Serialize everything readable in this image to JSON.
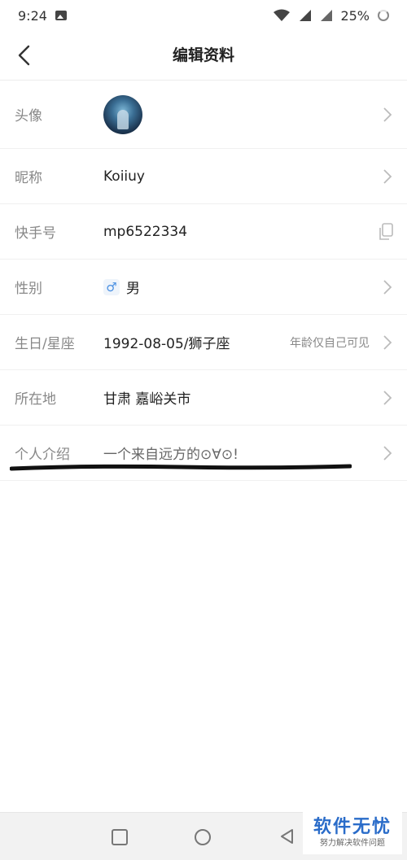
{
  "status_bar": {
    "time": "9:24",
    "battery": "25%"
  },
  "header": {
    "title": "编辑资料"
  },
  "rows": {
    "avatar": {
      "label": "头像"
    },
    "nickname": {
      "label": "昵称",
      "value": "Koiiuy"
    },
    "kuaishou_id": {
      "label": "快手号",
      "value": "mp6522334"
    },
    "gender": {
      "label": "性别",
      "value": "男",
      "icon": "male-icon"
    },
    "birthday": {
      "label": "生日/星座",
      "value": "1992-08-05/狮子座",
      "hint": "年龄仅自己可见"
    },
    "location": {
      "label": "所在地",
      "value": "甘肃 嘉峪关市"
    },
    "bio": {
      "label": "个人介绍",
      "value": "一个来自远方的⊙∀⊙!"
    }
  },
  "watermark": {
    "title": "软件无忧",
    "subtitle": "努力解决软件问题"
  },
  "colors": {
    "accent_blue": "#4a90e2",
    "watermark_blue": "#2a6cc9",
    "label_gray": "#888888"
  }
}
